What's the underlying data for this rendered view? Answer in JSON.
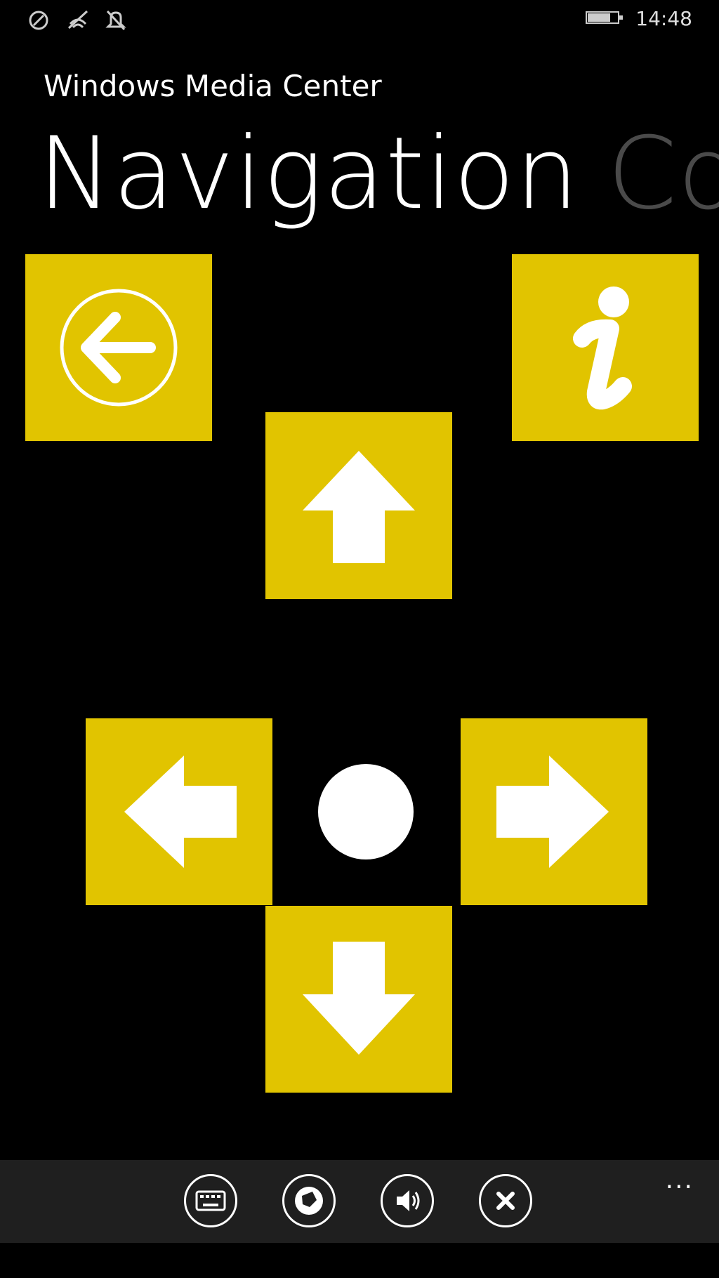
{
  "status_bar": {
    "time": "14:48",
    "icons": [
      "signal-icon",
      "wifi-icon",
      "notification-off-icon",
      "battery-icon"
    ]
  },
  "header": {
    "app_title": "Windows Media Center",
    "pivot_active": "Navigation",
    "pivot_next": "Co"
  },
  "tiles": {
    "back": "back-icon",
    "info": "info-icon",
    "up": "arrow-up-icon",
    "left": "arrow-left-icon",
    "ok": "ok-dot-icon",
    "right": "arrow-right-icon",
    "down": "arrow-down-icon"
  },
  "app_bar": {
    "buttons": [
      "keyboard-icon",
      "media-icon",
      "volume-icon",
      "close-icon"
    ],
    "more": "..."
  },
  "colors": {
    "accent": "#e1c400",
    "background": "#000000",
    "app_bar": "#1f1f1f",
    "pivot_inactive": "#4a4a4a"
  }
}
